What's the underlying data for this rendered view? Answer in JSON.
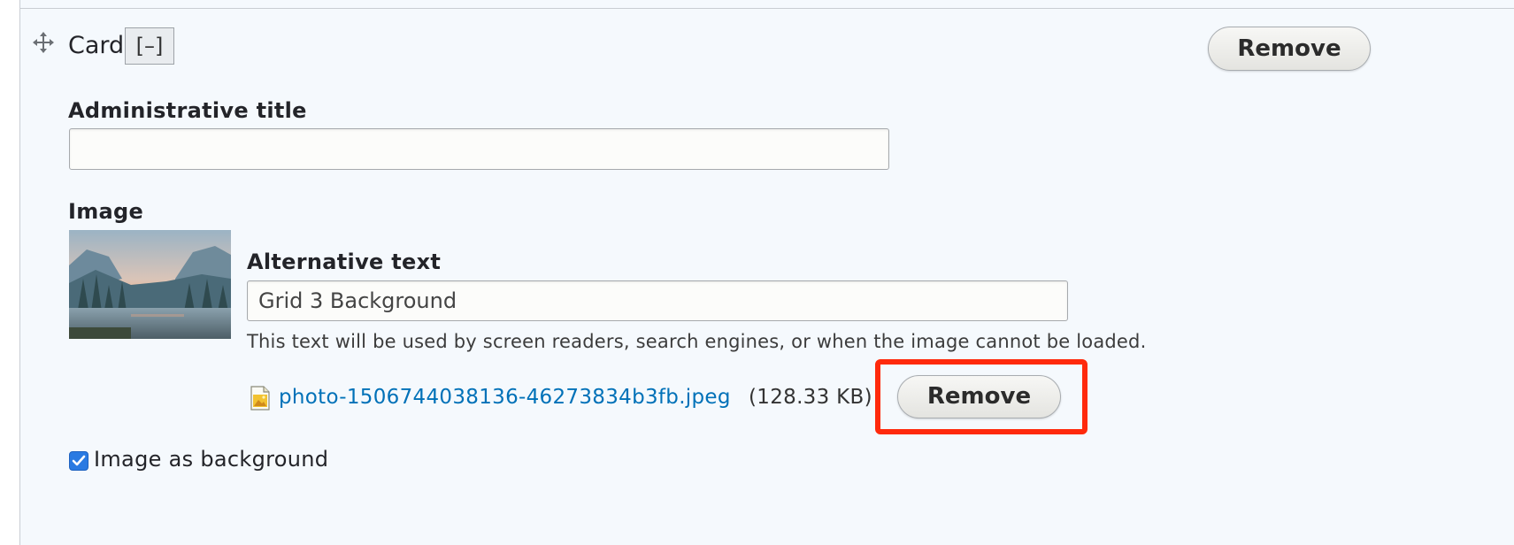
{
  "card": {
    "title": "Card",
    "collapse_label": "[–]",
    "remove_label": "Remove"
  },
  "admin_title": {
    "label": "Administrative title",
    "value": ""
  },
  "image": {
    "label": "Image",
    "alt_text_label": "Alternative text",
    "alt_text_value": "Grid 3 Background",
    "help_text": "This text will be used by screen readers, search engines, or when the image cannot be loaded.",
    "file_name": "photo-1506744038136-46273834b3fb.jpeg",
    "file_size": "(128.33 KB)",
    "remove_label": "Remove",
    "file_icon": "image-file-icon"
  },
  "background_option": {
    "label": "Image as background",
    "checked": true
  },
  "colors": {
    "panel_bg": "#f5f9fd",
    "link": "#0071b8",
    "highlight": "#ff2a0c",
    "checkbox": "#2a7ae2"
  }
}
